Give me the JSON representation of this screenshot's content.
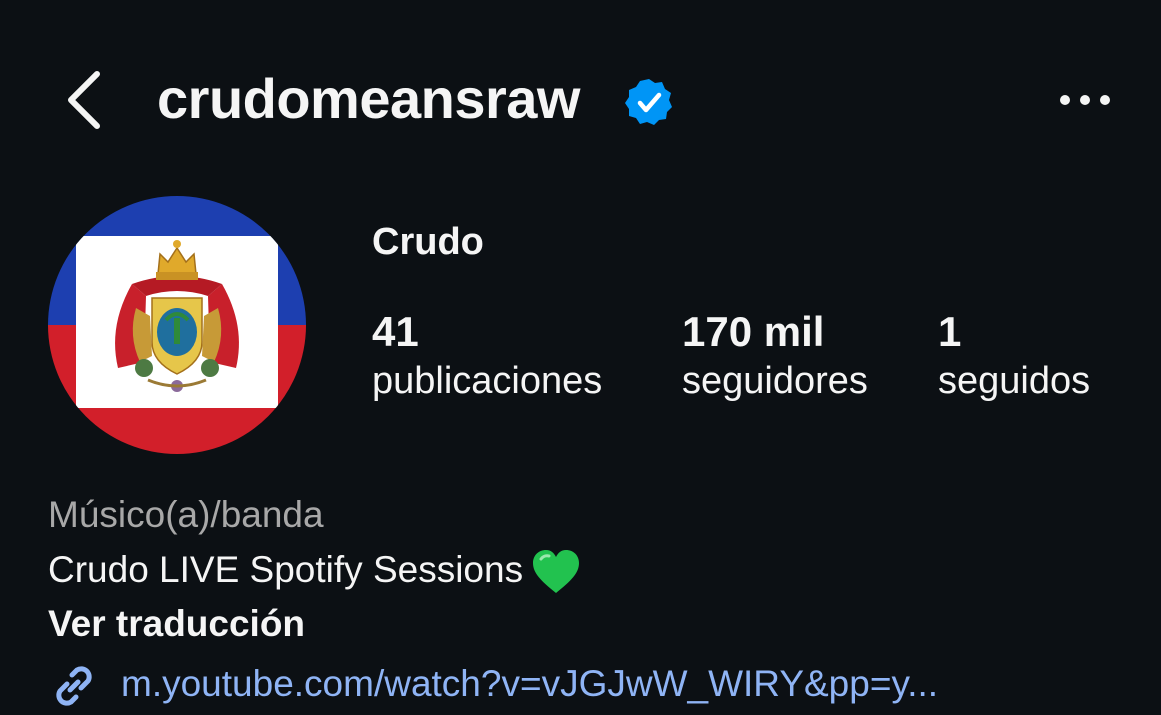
{
  "header": {
    "username": "crudomeansraw",
    "verified": true,
    "back_icon": "chevron-left-icon",
    "verified_icon": "verified-badge-icon",
    "more_icon": "more-horizontal-icon"
  },
  "profile": {
    "display_name": "Crudo",
    "avatar_description_icon": "flag-coat-of-arms-avatar",
    "stats": {
      "posts_count": "41",
      "posts_label": "publicaciones",
      "followers_count": "170 mil",
      "followers_label": "seguidores",
      "following_count": "1",
      "following_label": "seguidos"
    },
    "category": "Músico(a)/banda",
    "bio": "Crudo LIVE Spotify Sessions",
    "bio_emoji_icon": "green-heart-icon",
    "translate_label": "Ver traducción",
    "link_icon": "link-icon",
    "link_text": "m.youtube.com/watch?v=vJGJwW_WIRY&pp=y..."
  },
  "colors": {
    "background": "#0c1014",
    "text": "#f5f5f5",
    "secondary_text": "#a8a8a8",
    "link": "#8fb4f5",
    "verified_blue": "#0095f6",
    "flag_blue": "#1d3fb0",
    "flag_red": "#d21f2a",
    "heart_green": "#22c24f"
  }
}
